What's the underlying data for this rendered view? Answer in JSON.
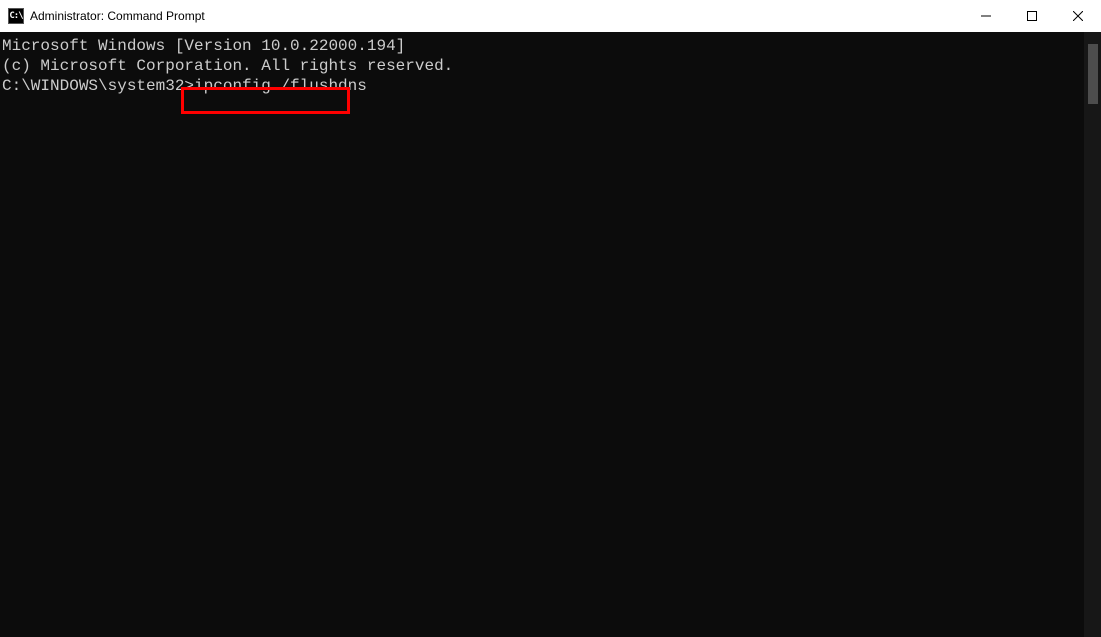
{
  "titlebar": {
    "icon_label": "C:\\",
    "title": "Administrator: Command Prompt"
  },
  "terminal": {
    "line1": "Microsoft Windows [Version 10.0.22000.194]",
    "line2": "(c) Microsoft Corporation. All rights reserved.",
    "blank": "",
    "prompt": "C:\\WINDOWS\\system32>",
    "command": "ipconfig /flushdns"
  },
  "highlight": {
    "target": "command"
  }
}
